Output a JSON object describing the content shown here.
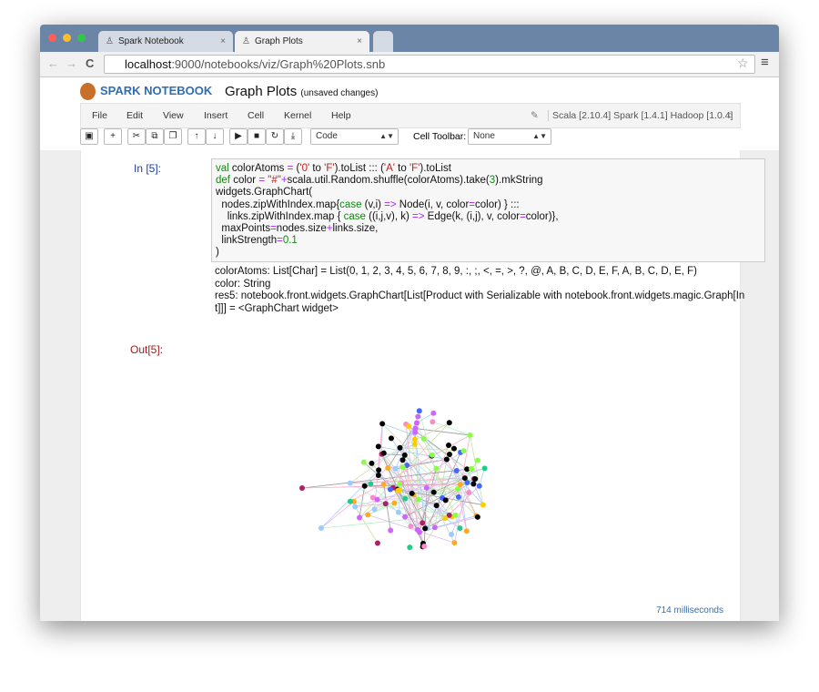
{
  "browser": {
    "tabs": [
      {
        "label": "Spark Notebook"
      },
      {
        "label": "Graph Plots"
      }
    ],
    "url_host": "localhost",
    "url_rest": ":9000/notebooks/viz/Graph%20Plots.snb"
  },
  "header": {
    "logo": "SPARK NOTEBOOK",
    "title": "Graph Plots",
    "status": "(unsaved changes)"
  },
  "menu": {
    "items": [
      "File",
      "Edit",
      "View",
      "Insert",
      "Cell",
      "Kernel",
      "Help"
    ],
    "kernel_info": "Scala [2.10.4] Spark [1.4.1] Hadoop [1.0.4]"
  },
  "toolbar": {
    "cell_type": "Code",
    "cell_toolbar_label": "Cell Toolbar:",
    "cell_toolbar_value": "None"
  },
  "cell": {
    "in_prompt": "In [5]:",
    "out_prompt": "Out[5]:",
    "output_lines": [
      "colorAtoms: List[Char] = List(0, 1, 2, 3, 4, 5, 6, 7, 8, 9, :, ;, <, =, >, ?, @, A, B, C, D, E, F, A, B, C, D, E, F)",
      "color: String",
      "res5: notebook.front.widgets.GraphChart[List[Product with Serializable with notebook.front.widgets.magic.Graph[In",
      "t]]] = <GraphChart widget>"
    ],
    "timing": "714 milliseconds"
  },
  "graph": {
    "node_colors": [
      "#000000",
      "#000000",
      "#000000",
      "#ff88cc",
      "#88ff44",
      "#4466ff",
      "#cc66ff",
      "#ffaa22",
      "#99ccff",
      "#aa2266",
      "#22cc88",
      "#ffcc00"
    ]
  }
}
